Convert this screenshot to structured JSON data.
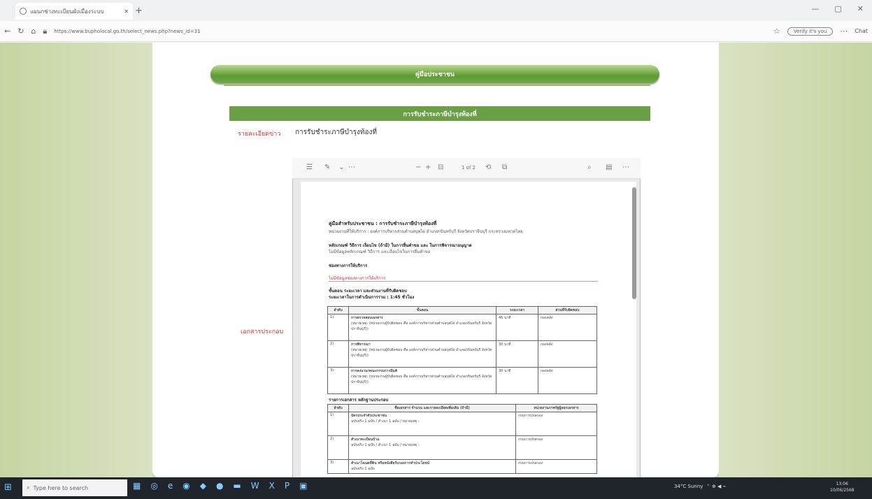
{
  "browser": {
    "tab_title": "แผนกช่างทะเบียนผังเมืองระบบ",
    "new_tab_icon": "+",
    "url": "https://www.bupholocal.go.th/select_news.php?news_id=31",
    "search_pill": "Verify it's you",
    "chat_label": "Chat"
  },
  "page": {
    "banner": "คู่มือประชาชน",
    "section_header": "การรับชำระภาษีบำรุงท้องที่",
    "topic_label": "รายละเอียดข่าว",
    "topic_value": "การรับชำระภาษีบำรุงท้องที่",
    "docs_label": "เอกสารประกอบ"
  },
  "pdf": {
    "page_indicator": "1 of 2",
    "doc_title": "คู่มือสำหรับประชาชน : การรับชำระภาษีบำรุงท้องที่",
    "agency": "หน่วยงานที่ให้บริการ : องค์การบริหารส่วนตำบลบุพไผ่ อำเภอกบินทร์บุรี จังหวัดปราจีนบุรี กระทรวงมหาดไทย",
    "criteria_title": "หลักเกณฑ์ วิธีการ เงื่อนไข (ถ้ามี) ในการยื่นคำขอ และ ในการพิจารณาอนุญาต",
    "criteria_text": "ไม่มีข้อมูลหลักเกณฑ์ วิธีการ และเงื่อนไขในการยื่นคำขอ",
    "channel_title": "ช่องทางการให้บริการ",
    "channel_text": "ไม่มีข้อมูลช่องทางการให้บริการ",
    "steps_title": "ขั้นตอน ระยะเวลา และส่วนงานที่รับผิดชอบ",
    "duration": "ระยะเวลาในการดำเนินการรวม : 1:45 ชั่วโมง",
    "steps_headers": [
      "ลำดับ",
      "ขั้นตอน",
      "ระยะเวลา",
      "ส่วนที่รับผิดชอบ"
    ],
    "steps": [
      {
        "no": "1)",
        "name": "การตรวจสอบเอกสาร",
        "note": "(หมายเหตุ: (หน่วยงานผู้รับผิดชอบ คือ องค์การบริหารส่วนตำบลบุพไผ่ อำเภอกบินทร์บุรี จังหวัดปราจีนบุรี))",
        "time": "45 นาที",
        "unit": "กองคลัง"
      },
      {
        "no": "2)",
        "name": "การพิจารณา",
        "note": "(หมายเหตุ: (หน่วยงานผู้รับผิดชอบ คือ องค์การบริหารส่วนตำบลบุพไผ่ อำเภอกบินทร์บุรี จังหวัดปราจีนบุรี))",
        "time": "30 นาที",
        "unit": "กองคลัง"
      },
      {
        "no": "3)",
        "name": "การลงนาม/คณะกรรมการมีมติ",
        "note": "(หมายเหตุ: (หน่วยงานผู้รับผิดชอบ คือ องค์การบริหารส่วนตำบลบุพไผ่ อำเภอกบินทร์บุรี จังหวัดปราจีนบุรี))",
        "time": "30 นาที",
        "unit": "กองคลัง"
      }
    ],
    "docs_title": "รายการเอกสาร หลักฐานประกอบ",
    "docs_headers": [
      "ลำดับ",
      "ชื่อเอกสาร จำนวน และรายละเอียดเพิ่มเติม (ถ้ามี)",
      "หน่วยงานภาครัฐผู้ออกเอกสาร"
    ],
    "docs": [
      {
        "no": "1)",
        "name": "บัตรประจำตัวประชาชน",
        "detail": "ฉบับจริง 1 ฉบับ / สำเนา 1 ฉบับ / หมายเหตุ -",
        "agency": "กรมการปกครอง"
      },
      {
        "no": "2)",
        "name": "สำเนาทะเบียนบ้าน",
        "detail": "ฉบับจริง 1 ฉบับ / สำเนา 1 ฉบับ / หมายเหตุ -",
        "agency": "กรมการปกครอง"
      },
      {
        "no": "3)",
        "name": "สำเนาโฉนดที่ดิน หรือหนังสือรับรองการทำประโยชน์",
        "detail": "ฉบับจริง 1 ฉบับ",
        "agency": "กรมการปกครอง"
      }
    ]
  },
  "taskbar": {
    "search_placeholder": "Type here to search",
    "weather": "34°C Sunny",
    "time": "13:06",
    "date": "10/06/2568"
  }
}
